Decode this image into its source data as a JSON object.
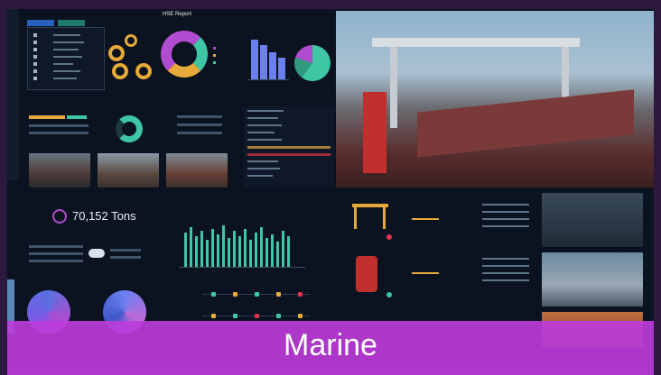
{
  "header": {
    "title": "HSE Report"
  },
  "tonnage": {
    "value": "70,152",
    "unit": "Tons"
  },
  "banner": {
    "label": "Marine"
  },
  "nav": {
    "tabs": [
      "",
      ""
    ],
    "items": [
      "",
      "",
      "",
      "",
      "",
      "",
      ""
    ]
  },
  "colors": {
    "accent": "#3fc6a5",
    "highlight": "#e7a93a",
    "brand": "#be3cdc",
    "alert": "#e0334a"
  }
}
